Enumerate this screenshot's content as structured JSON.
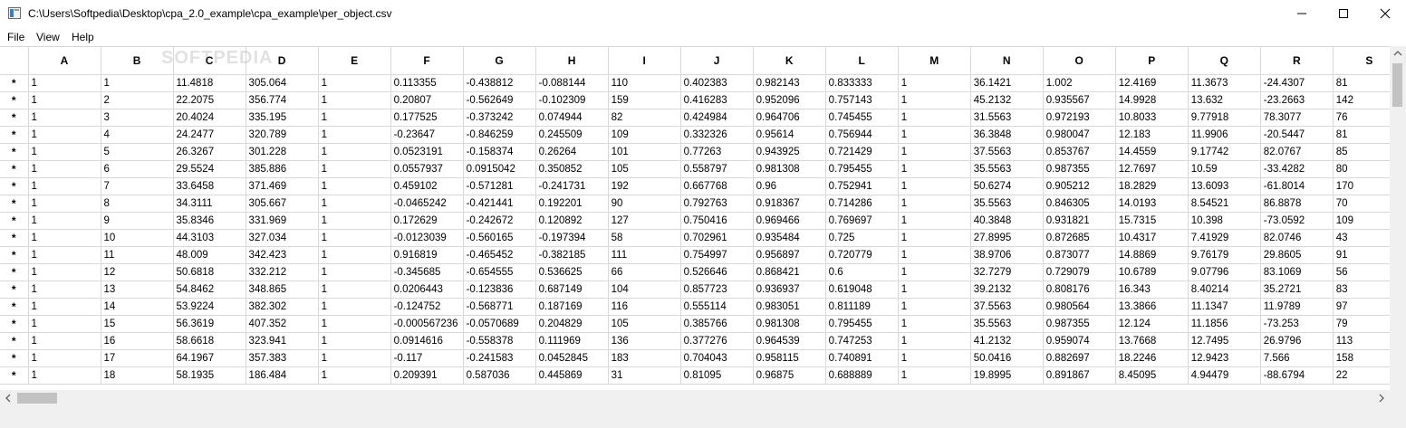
{
  "window": {
    "title": "C:\\Users\\Softpedia\\Desktop\\cpa_2.0_example\\cpa_example\\per_object.csv"
  },
  "menu": [
    "File",
    "View",
    "Help"
  ],
  "watermark": "SOFTPEDIA",
  "table": {
    "row_marker": "*",
    "columns": [
      "A",
      "B",
      "C",
      "D",
      "E",
      "F",
      "G",
      "H",
      "I",
      "J",
      "K",
      "L",
      "M",
      "N",
      "O",
      "P",
      "Q",
      "R",
      "S"
    ],
    "rows": [
      [
        "1",
        "1",
        "11.4818",
        "305.064",
        "1",
        "0.113355",
        "-0.438812",
        "-0.088144",
        "110",
        "0.402383",
        "0.982143",
        "0.833333",
        "1",
        "36.1421",
        "1.002",
        "12.4169",
        "11.3673",
        "-24.4307",
        "81"
      ],
      [
        "1",
        "2",
        "22.2075",
        "356.774",
        "1",
        "0.20807",
        "-0.562649",
        "-0.102309",
        "159",
        "0.416283",
        "0.952096",
        "0.757143",
        "1",
        "45.2132",
        "0.935567",
        "14.9928",
        "13.632",
        "-23.2663",
        "142"
      ],
      [
        "1",
        "3",
        "20.4024",
        "335.195",
        "1",
        "0.177525",
        "-0.373242",
        "0.074944",
        "82",
        "0.424984",
        "0.964706",
        "0.745455",
        "1",
        "31.5563",
        "0.972193",
        "10.8033",
        "9.77918",
        "78.3077",
        "76"
      ],
      [
        "1",
        "4",
        "24.2477",
        "320.789",
        "1",
        "-0.23647",
        "-0.846259",
        "0.245509",
        "109",
        "0.332326",
        "0.95614",
        "0.756944",
        "1",
        "36.3848",
        "0.980047",
        "12.183",
        "11.9906",
        "-20.5447",
        "81"
      ],
      [
        "1",
        "5",
        "26.3267",
        "301.228",
        "1",
        "0.0523191",
        "-0.158374",
        "0.26264",
        "101",
        "0.77263",
        "0.943925",
        "0.721429",
        "1",
        "37.5563",
        "0.853767",
        "14.4559",
        "9.17742",
        "82.0767",
        "85"
      ],
      [
        "1",
        "6",
        "29.5524",
        "385.886",
        "1",
        "0.0557937",
        "0.0915042",
        "0.350852",
        "105",
        "0.558797",
        "0.981308",
        "0.795455",
        "1",
        "35.5563",
        "0.987355",
        "12.7697",
        "10.59",
        "-33.4282",
        "80"
      ],
      [
        "1",
        "7",
        "33.6458",
        "371.469",
        "1",
        "0.459102",
        "-0.571281",
        "-0.241731",
        "192",
        "0.667768",
        "0.96",
        "0.752941",
        "1",
        "50.6274",
        "0.905212",
        "18.2829",
        "13.6093",
        "-61.8014",
        "170"
      ],
      [
        "1",
        "8",
        "34.3111",
        "305.667",
        "1",
        "-0.0465242",
        "-0.421441",
        "0.192201",
        "90",
        "0.792763",
        "0.918367",
        "0.714286",
        "1",
        "35.5563",
        "0.846305",
        "14.0193",
        "8.54521",
        "86.8878",
        "70"
      ],
      [
        "1",
        "9",
        "35.8346",
        "331.969",
        "1",
        "0.172629",
        "-0.242672",
        "0.120892",
        "127",
        "0.750416",
        "0.969466",
        "0.769697",
        "1",
        "40.3848",
        "0.931821",
        "15.7315",
        "10.398",
        "-73.0592",
        "109"
      ],
      [
        "1",
        "10",
        "44.3103",
        "327.034",
        "1",
        "-0.0123039",
        "-0.560165",
        "-0.197394",
        "58",
        "0.702961",
        "0.935484",
        "0.725",
        "1",
        "27.8995",
        "0.872685",
        "10.4317",
        "7.41929",
        "82.0746",
        "43"
      ],
      [
        "1",
        "11",
        "48.009",
        "342.423",
        "1",
        "0.916819",
        "-0.465452",
        "-0.382185",
        "111",
        "0.754997",
        "0.956897",
        "0.720779",
        "1",
        "38.9706",
        "0.873077",
        "14.8869",
        "9.76179",
        "29.8605",
        "91"
      ],
      [
        "1",
        "12",
        "50.6818",
        "332.212",
        "1",
        "-0.345685",
        "-0.654555",
        "0.536625",
        "66",
        "0.526646",
        "0.868421",
        "0.6",
        "1",
        "32.7279",
        "0.729079",
        "10.6789",
        "9.07796",
        "83.1069",
        "56"
      ],
      [
        "1",
        "13",
        "54.8462",
        "348.865",
        "1",
        "0.0206443",
        "-0.123836",
        "0.687149",
        "104",
        "0.857723",
        "0.936937",
        "0.619048",
        "1",
        "39.2132",
        "0.808176",
        "16.343",
        "8.40214",
        "35.2721",
        "83"
      ],
      [
        "1",
        "14",
        "53.9224",
        "382.302",
        "1",
        "-0.124752",
        "-0.568771",
        "0.187169",
        "116",
        "0.555114",
        "0.983051",
        "0.811189",
        "1",
        "37.5563",
        "0.980564",
        "13.3866",
        "11.1347",
        "11.9789",
        "97"
      ],
      [
        "1",
        "15",
        "56.3619",
        "407.352",
        "1",
        "-0.000567236",
        "-0.0570689",
        "0.204829",
        "105",
        "0.385766",
        "0.981308",
        "0.795455",
        "1",
        "35.5563",
        "0.987355",
        "12.124",
        "11.1856",
        "-73.253",
        "79"
      ],
      [
        "1",
        "16",
        "58.6618",
        "323.941",
        "1",
        "0.0914616",
        "-0.558378",
        "0.111969",
        "136",
        "0.377276",
        "0.964539",
        "0.747253",
        "1",
        "41.2132",
        "0.959074",
        "13.7668",
        "12.7495",
        "26.9796",
        "113"
      ],
      [
        "1",
        "17",
        "64.1967",
        "357.383",
        "1",
        "-0.117",
        "-0.241583",
        "0.0452845",
        "183",
        "0.704043",
        "0.958115",
        "0.740891",
        "1",
        "50.0416",
        "0.882697",
        "18.2246",
        "12.9423",
        "7.566",
        "158"
      ],
      [
        "1",
        "18",
        "58.1935",
        "186.484",
        "1",
        "0.209391",
        "0.587036",
        "0.445869",
        "31",
        "0.81095",
        "0.96875",
        "0.688889",
        "1",
        "19.8995",
        "0.891867",
        "8.45095",
        "4.94479",
        "-88.6794",
        "22"
      ]
    ]
  }
}
